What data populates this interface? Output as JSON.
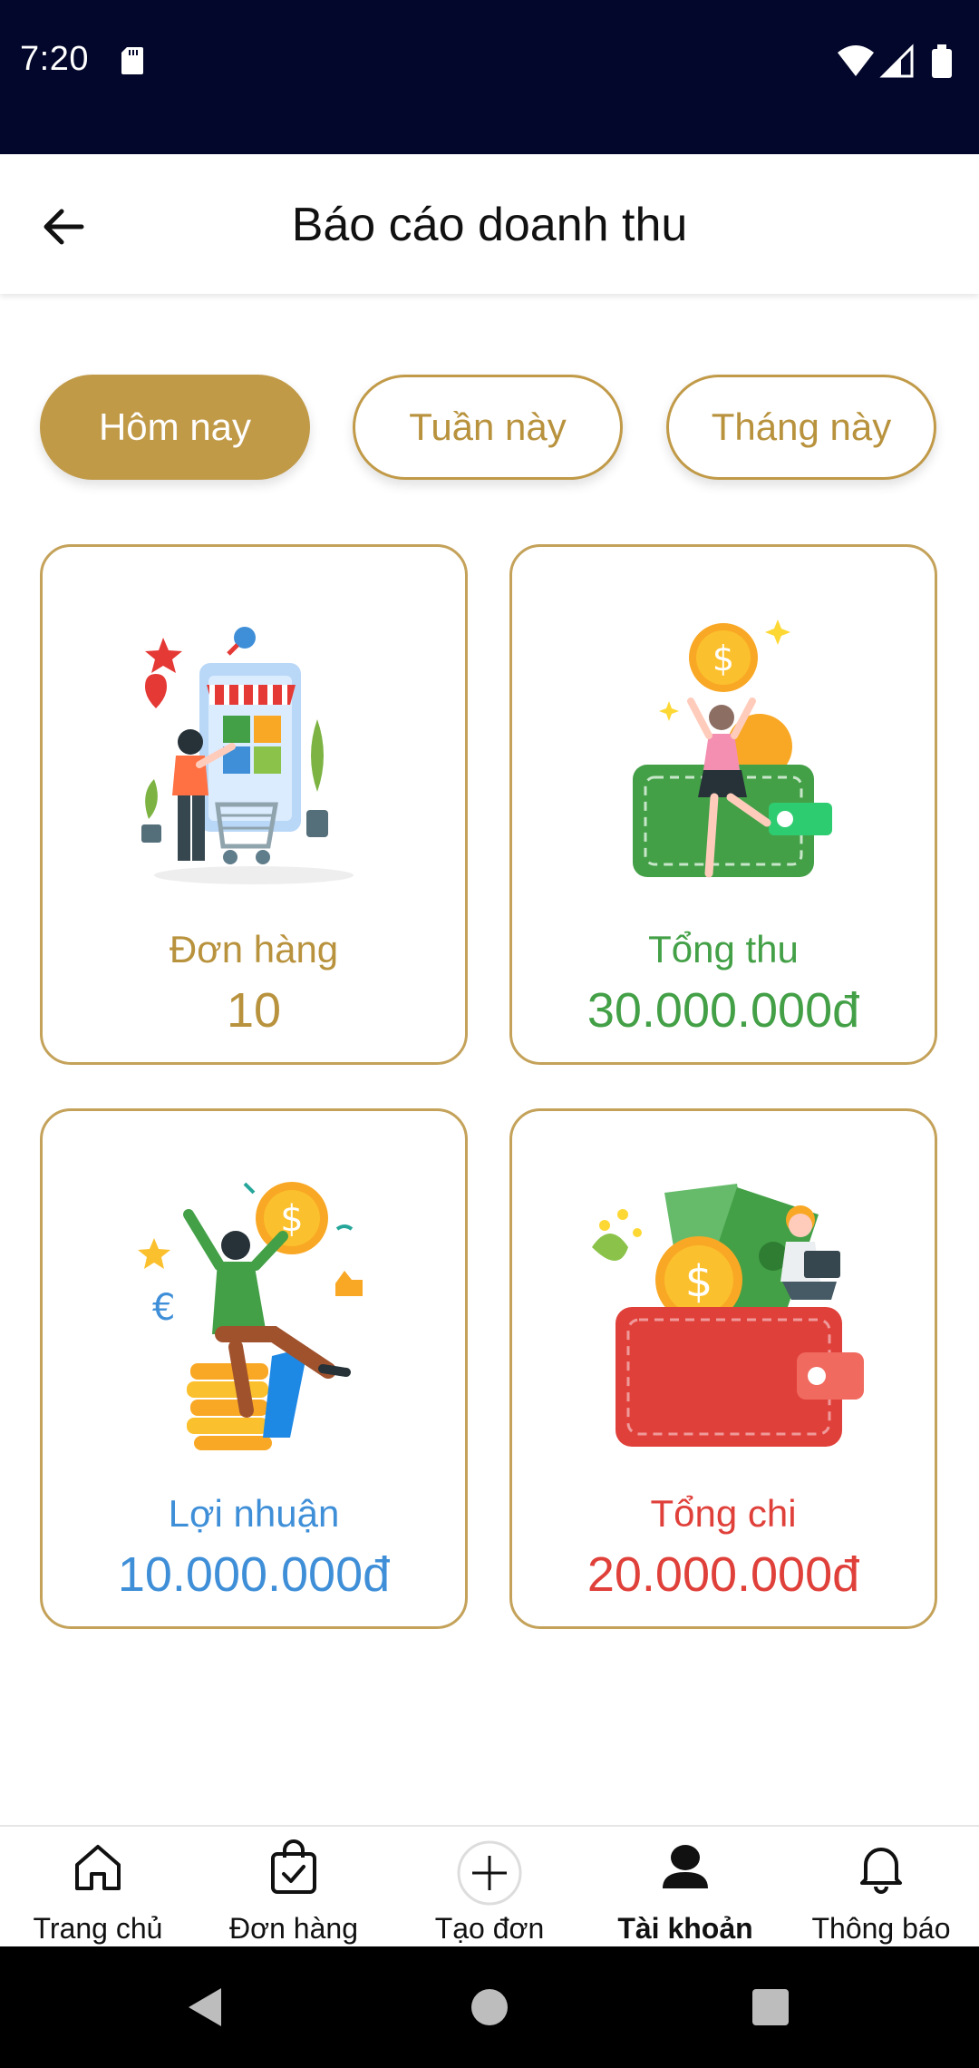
{
  "status_bar": {
    "time": "7:20"
  },
  "app_bar": {
    "title": "Báo cáo doanh thu"
  },
  "tabs": [
    {
      "label": "Hôm nay",
      "active": true
    },
    {
      "label": "Tuần này",
      "active": false
    },
    {
      "label": "Tháng này",
      "active": false
    }
  ],
  "cards": [
    {
      "label": "Đơn hàng",
      "value": "10",
      "color": "#b8923d"
    },
    {
      "label": "Tổng thu",
      "value": "30.000.000đ",
      "color": "#43a047"
    },
    {
      "label": "Lợi nhuận",
      "value": "10.000.000đ",
      "color": "#3f8fd8"
    },
    {
      "label": "Tổng chi",
      "value": "20.000.000đ",
      "color": "#e0403a"
    }
  ],
  "bottom_nav": [
    {
      "label": "Trang chủ",
      "icon": "home-icon"
    },
    {
      "label": "Đơn hàng",
      "icon": "shopping-bag-icon"
    },
    {
      "label": "Tạo đơn",
      "icon": "plus-circle-icon"
    },
    {
      "label": "Tài khoản",
      "icon": "user-icon",
      "active": true
    },
    {
      "label": "Thông báo",
      "icon": "bell-icon"
    }
  ],
  "colors": {
    "accent": "#c19a48",
    "status_bar": "#03072b"
  }
}
